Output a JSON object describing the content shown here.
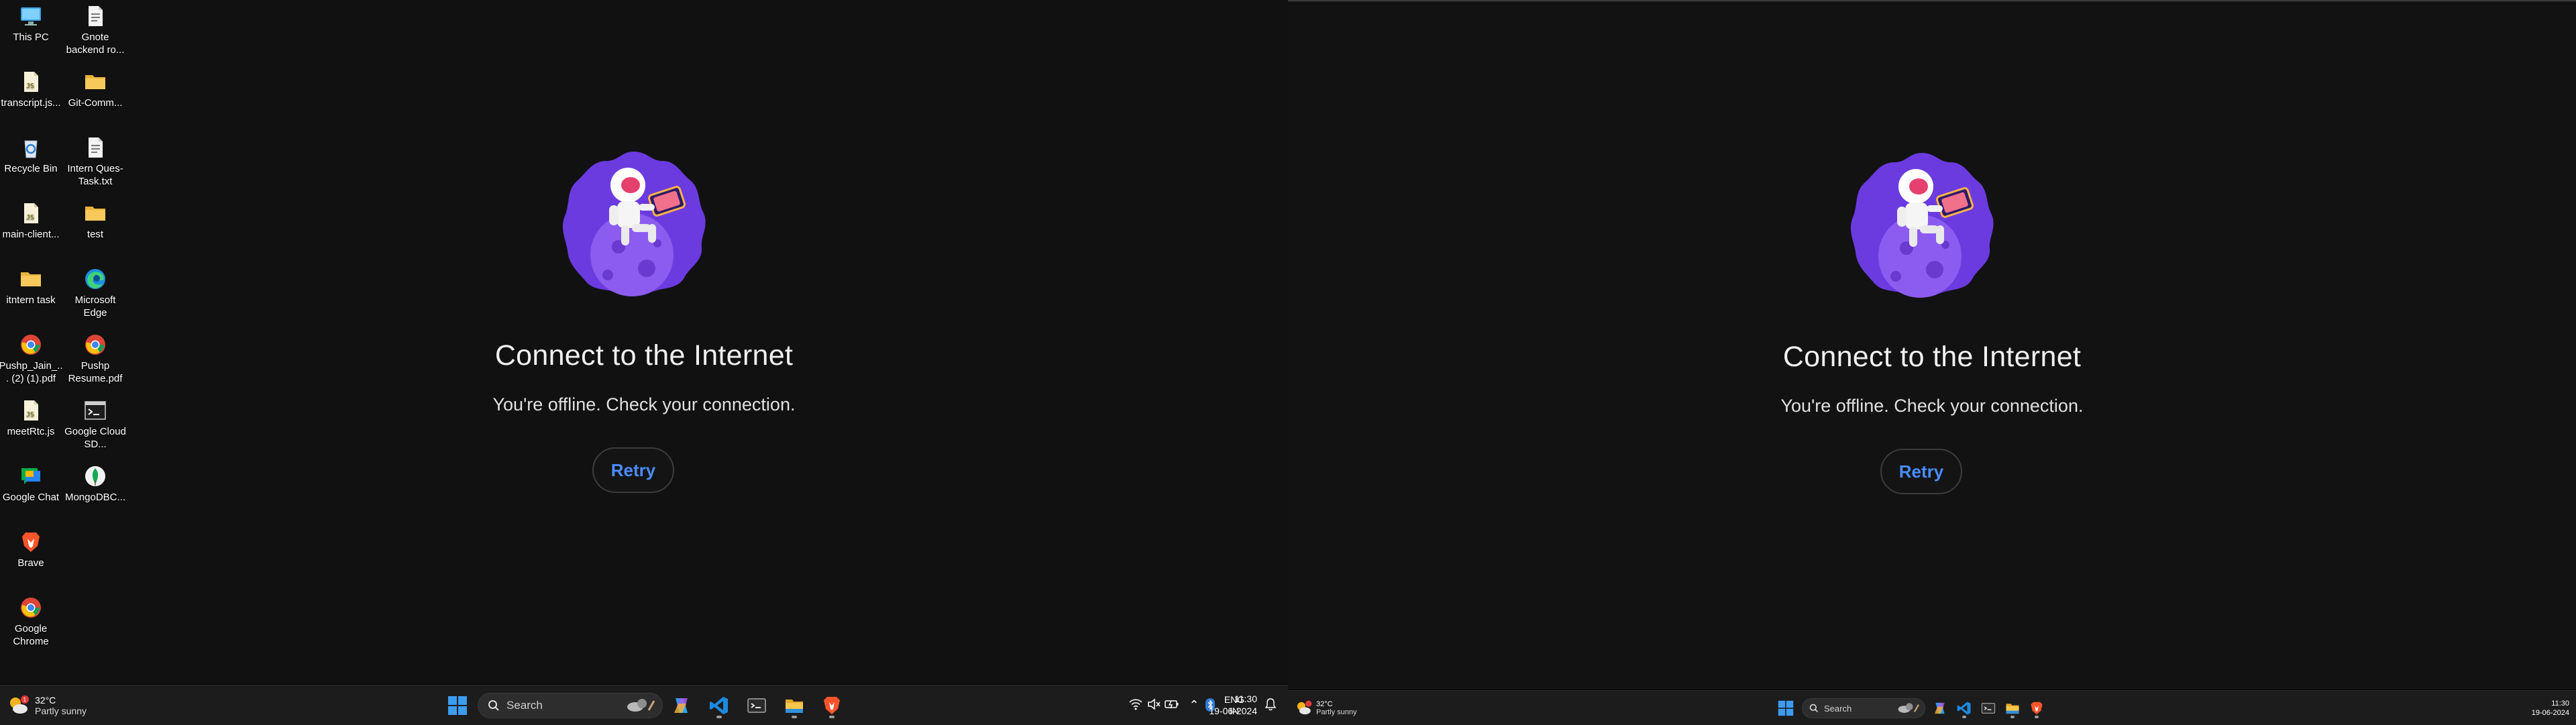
{
  "offline_page": {
    "title": "Connect to the Internet",
    "message": "You're offline. Check your connection.",
    "retry_label": "Retry"
  },
  "desktop_icons": [
    {
      "label": "This PC",
      "icon": "this-pc-icon"
    },
    {
      "label": "Gnote backend ro...",
      "icon": "text-file-icon"
    },
    {
      "label": "transcript.js...",
      "icon": "js-file-icon"
    },
    {
      "label": "Git-Comm...",
      "icon": "folder-icon"
    },
    {
      "label": "Recycle Bin",
      "icon": "recycle-bin-icon"
    },
    {
      "label": "Intern Ques-Task.txt",
      "icon": "text-file-icon"
    },
    {
      "label": "main-client...",
      "icon": "js-file-icon"
    },
    {
      "label": "test",
      "icon": "folder-icon"
    },
    {
      "label": "itntern task",
      "icon": "folder-icon"
    },
    {
      "label": "Microsoft Edge",
      "icon": "edge-icon"
    },
    {
      "label": "Pushp_Jain_... (2) (1).pdf",
      "icon": "chrome-pdf-icon"
    },
    {
      "label": "Pushp Resume.pdf",
      "icon": "chrome-pdf-icon"
    },
    {
      "label": "meetRtc.js",
      "icon": "js-file-icon"
    },
    {
      "label": "Google Cloud SD...",
      "icon": "terminal-icon"
    },
    {
      "label": "Google Chat",
      "icon": "google-chat-icon"
    },
    {
      "label": "MongoDBC...",
      "icon": "mongodb-icon"
    },
    {
      "label": "Brave",
      "icon": "brave-icon"
    },
    {
      "label": "Google Chrome",
      "icon": "chrome-icon"
    }
  ],
  "taskbar_left": {
    "weather_temp": "32°C",
    "weather_desc": "Partly sunny",
    "weather_badge": "1",
    "search_label": "Search",
    "language_top": "ENG",
    "language_bottom": "IN",
    "time": "11:30",
    "date": "19-06-2024"
  },
  "taskbar_right": {
    "weather_temp": "32°C",
    "weather_desc": "Partly sunny",
    "search_label": "Search",
    "time": "11:30",
    "date": "19-06-2024"
  },
  "colors": {
    "accent_blue": "#4a8cff",
    "taskbar_bg": "#1c1c1c",
    "page_bg": "#111111"
  }
}
